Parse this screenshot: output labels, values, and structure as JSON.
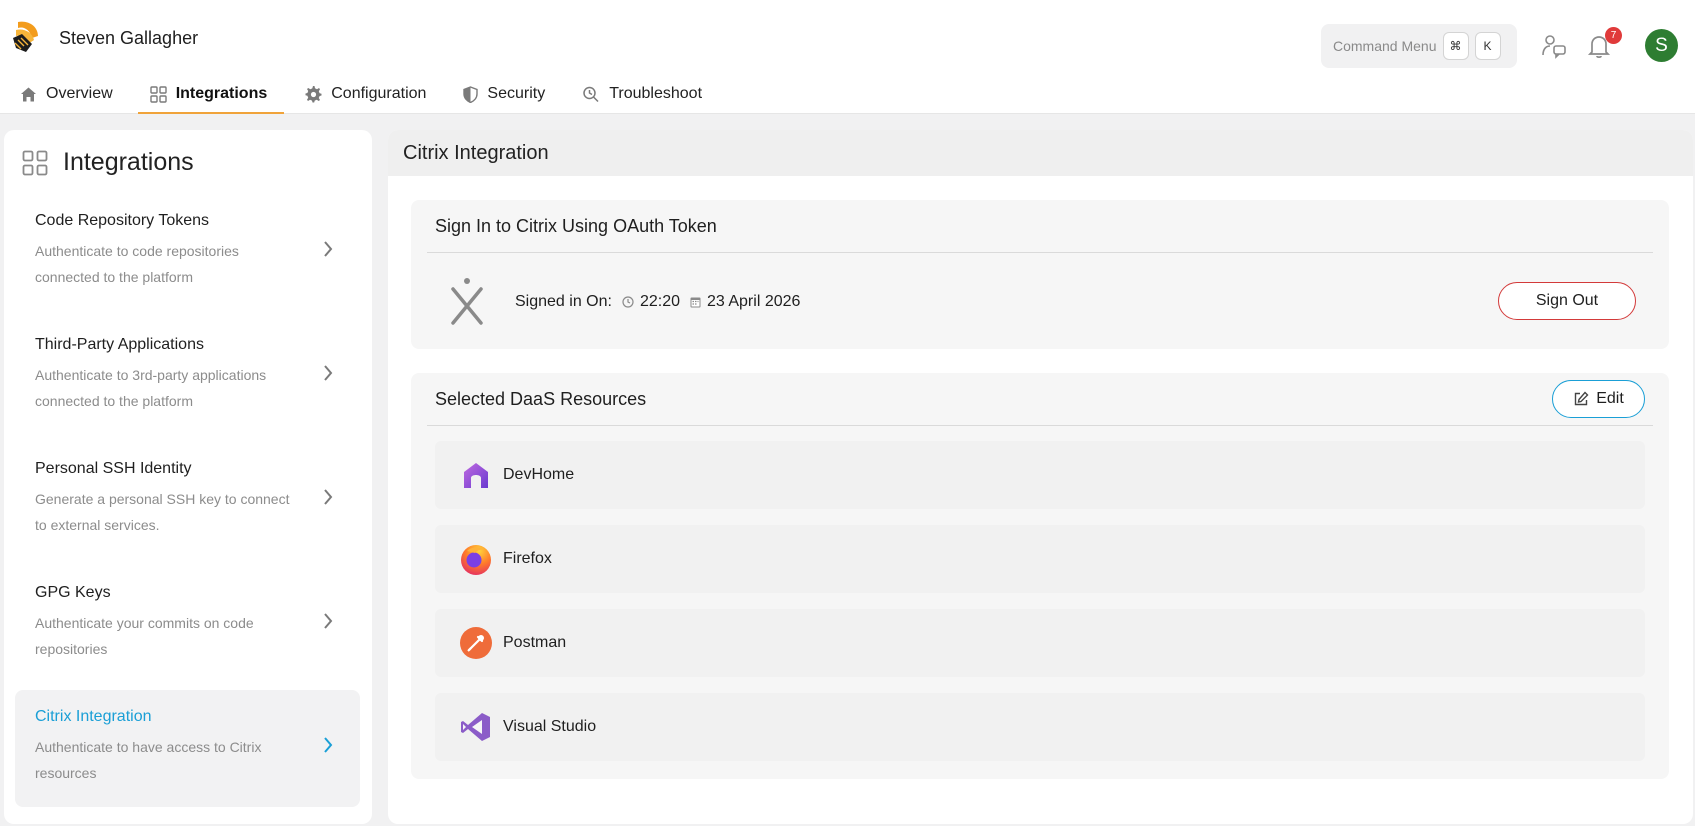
{
  "header": {
    "user_name": "Steven Gallagher",
    "command_menu": {
      "label": "Command Menu",
      "key1": "⌘",
      "key2": "K"
    },
    "notification_count": "7",
    "avatar_initial": "S"
  },
  "tabs": [
    {
      "label": "Overview",
      "icon": "home-icon"
    },
    {
      "label": "Integrations",
      "icon": "grid-icon",
      "active": true
    },
    {
      "label": "Configuration",
      "icon": "gear-icon"
    },
    {
      "label": "Security",
      "icon": "shield-icon"
    },
    {
      "label": "Troubleshoot",
      "icon": "troubleshoot-icon"
    }
  ],
  "sidebar": {
    "title": "Integrations",
    "items": [
      {
        "title": "Code Repository Tokens",
        "desc": "Authenticate to code repositories connected to the platform"
      },
      {
        "title": "Third-Party Applications",
        "desc": "Authenticate to 3rd-party applications connected to the platform"
      },
      {
        "title": "Personal SSH Identity",
        "desc": "Generate a personal SSH key to connect to external services."
      },
      {
        "title": "GPG Keys",
        "desc": "Authenticate your commits on code repositories"
      },
      {
        "title": "Citrix Integration",
        "desc": "Authenticate to have access to Citrix resources",
        "active": true
      }
    ]
  },
  "main": {
    "title": "Citrix Integration",
    "signin": {
      "title": "Sign In to Citrix Using OAuth Token",
      "signed_label": "Signed in On:",
      "time": "22:20",
      "date": "23 April 2026",
      "sign_out": "Sign Out"
    },
    "resources": {
      "title": "Selected DaaS Resources",
      "edit": "Edit",
      "items": [
        {
          "name": "DevHome",
          "icon": "devhome-icon"
        },
        {
          "name": "Firefox",
          "icon": "firefox-icon"
        },
        {
          "name": "Postman",
          "icon": "postman-icon"
        },
        {
          "name": "Visual Studio",
          "icon": "visual-studio-icon"
        }
      ]
    }
  },
  "colors": {
    "accent_orange": "#f0a33a",
    "accent_blue": "#1a9fd6",
    "danger": "#d33a3a",
    "avatar": "#2e7d32"
  }
}
